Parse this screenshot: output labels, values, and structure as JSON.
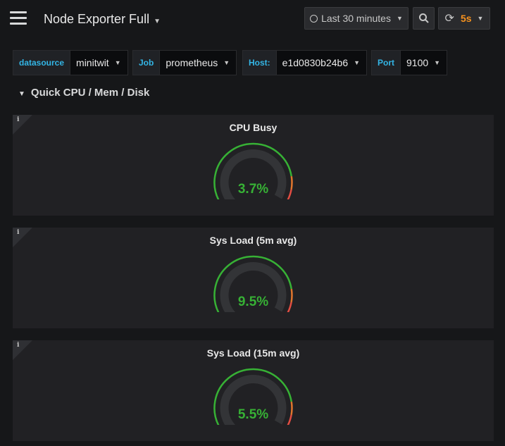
{
  "header": {
    "title": "Node Exporter Full",
    "time_range": "Last 30 minutes",
    "refresh_interval": "5s"
  },
  "variables": [
    {
      "label": "datasource",
      "value": "minitwit"
    },
    {
      "label": "Job",
      "value": "prometheus"
    },
    {
      "label": "Host:",
      "value": "e1d0830b24b6"
    },
    {
      "label": "Port",
      "value": "9100"
    }
  ],
  "row": {
    "title": "Quick CPU / Mem / Disk"
  },
  "panels": [
    {
      "title": "CPU Busy",
      "value": "3.7%",
      "percent": 3.7
    },
    {
      "title": "Sys Load (5m avg)",
      "value": "9.5%",
      "percent": 9.5
    },
    {
      "title": "Sys Load (15m avg)",
      "value": "5.5%",
      "percent": 5.5
    }
  ],
  "colors": {
    "ok": "#37b135",
    "warn": "#e0752d",
    "crit": "#e24d42",
    "link": "#33b5e5",
    "accent": "#f7921e"
  }
}
